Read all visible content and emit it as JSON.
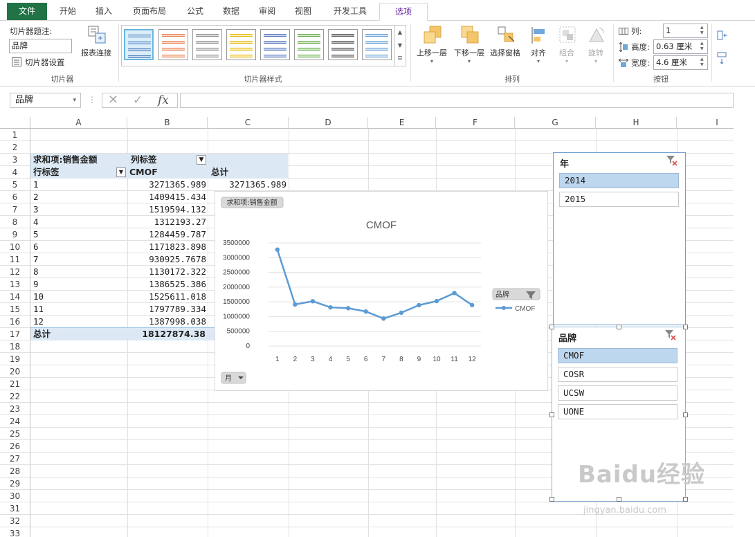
{
  "tabs": {
    "file": "文件",
    "home": "开始",
    "insert": "插入",
    "layout": "页面布局",
    "formula": "公式",
    "data": "数据",
    "review": "审阅",
    "view": "视图",
    "dev": "开发工具",
    "options": "选项"
  },
  "ribbon": {
    "caption_label": "切片器题注:",
    "caption_value": "品牌",
    "settings_label": "切片器设置",
    "report_conn_label": "报表连接",
    "group_slicer": "切片器",
    "group_styles": "切片器样式",
    "bring_forward": "上移一层",
    "send_backward": "下移一层",
    "selection_pane": "选择窗格",
    "align": "对齐",
    "group": "组合",
    "rotate": "旋转",
    "group_arrange": "排列",
    "columns_label": "列:",
    "columns_value": "1",
    "height_label": "高度:",
    "height_value": "0.63 厘米",
    "width_label": "宽度:",
    "width_value": "4.6 厘米",
    "group_buttons": "按钮"
  },
  "formula_bar": {
    "name_box": "品牌",
    "fx": "fx",
    "formula": ""
  },
  "columns": [
    "A",
    "B",
    "C",
    "D",
    "E",
    "F",
    "G",
    "H",
    "I"
  ],
  "rows": [
    "1",
    "2",
    "3",
    "4",
    "5",
    "6",
    "7",
    "8",
    "9",
    "10",
    "11",
    "12",
    "13",
    "14",
    "15",
    "16",
    "17",
    "18",
    "19",
    "20",
    "21",
    "22",
    "23",
    "24",
    "25",
    "26",
    "27",
    "28",
    "29",
    "30",
    "31",
    "32",
    "33"
  ],
  "pivot": {
    "sum_label": "求和项:销售金额",
    "col_label": "列标签",
    "row_label": "行标签",
    "col_name": "CMOF",
    "total_label": "总计",
    "row5_total": "3271365.989",
    "rows": [
      {
        "k": "1",
        "v": "3271365.989"
      },
      {
        "k": "2",
        "v": "1409415.434"
      },
      {
        "k": "3",
        "v": "1519594.132"
      },
      {
        "k": "4",
        "v": "1312193.27"
      },
      {
        "k": "5",
        "v": "1284459.787"
      },
      {
        "k": "6",
        "v": "1171823.898"
      },
      {
        "k": "7",
        "v": "930925.7678"
      },
      {
        "k": "8",
        "v": "1130172.322"
      },
      {
        "k": "9",
        "v": "1386525.386"
      },
      {
        "k": "10",
        "v": "1525611.018"
      },
      {
        "k": "11",
        "v": "1797789.334"
      },
      {
        "k": "12",
        "v": "1387998.038"
      }
    ],
    "grand_total_label": "总计",
    "grand_total": "18127874.38"
  },
  "chart_data": {
    "type": "line",
    "title": "CMOF",
    "field_button": "求和项:销售金额",
    "axis_button": "月",
    "legend_button": "品牌",
    "categories": [
      "1",
      "2",
      "3",
      "4",
      "5",
      "6",
      "7",
      "8",
      "9",
      "10",
      "11",
      "12"
    ],
    "series": [
      {
        "name": "CMOF",
        "values": [
          3271365.989,
          1409415.434,
          1519594.132,
          1312193.27,
          1284459.787,
          1171823.898,
          930925.7678,
          1130172.322,
          1386525.386,
          1525611.018,
          1797789.334,
          1387998.038
        ]
      }
    ],
    "ylim": [
      0,
      3500000
    ],
    "yticks": [
      "3500000",
      "3000000",
      "2500000",
      "2000000",
      "1500000",
      "1000000",
      "500000",
      "0"
    ],
    "color": "#5b9bd5",
    "legend_position": "right",
    "grid": true
  },
  "slicer_year": {
    "title": "年",
    "items": [
      {
        "label": "2014",
        "selected": true
      },
      {
        "label": "2015",
        "selected": false
      }
    ]
  },
  "slicer_brand": {
    "title": "品牌",
    "items": [
      {
        "label": "CMOF",
        "selected": true
      },
      {
        "label": "COSR",
        "selected": false
      },
      {
        "label": "UCSW",
        "selected": false
      },
      {
        "label": "UONE",
        "selected": false
      }
    ]
  },
  "watermark": {
    "main": "Baidu经验",
    "sub": "jingyan.baidu.com"
  }
}
